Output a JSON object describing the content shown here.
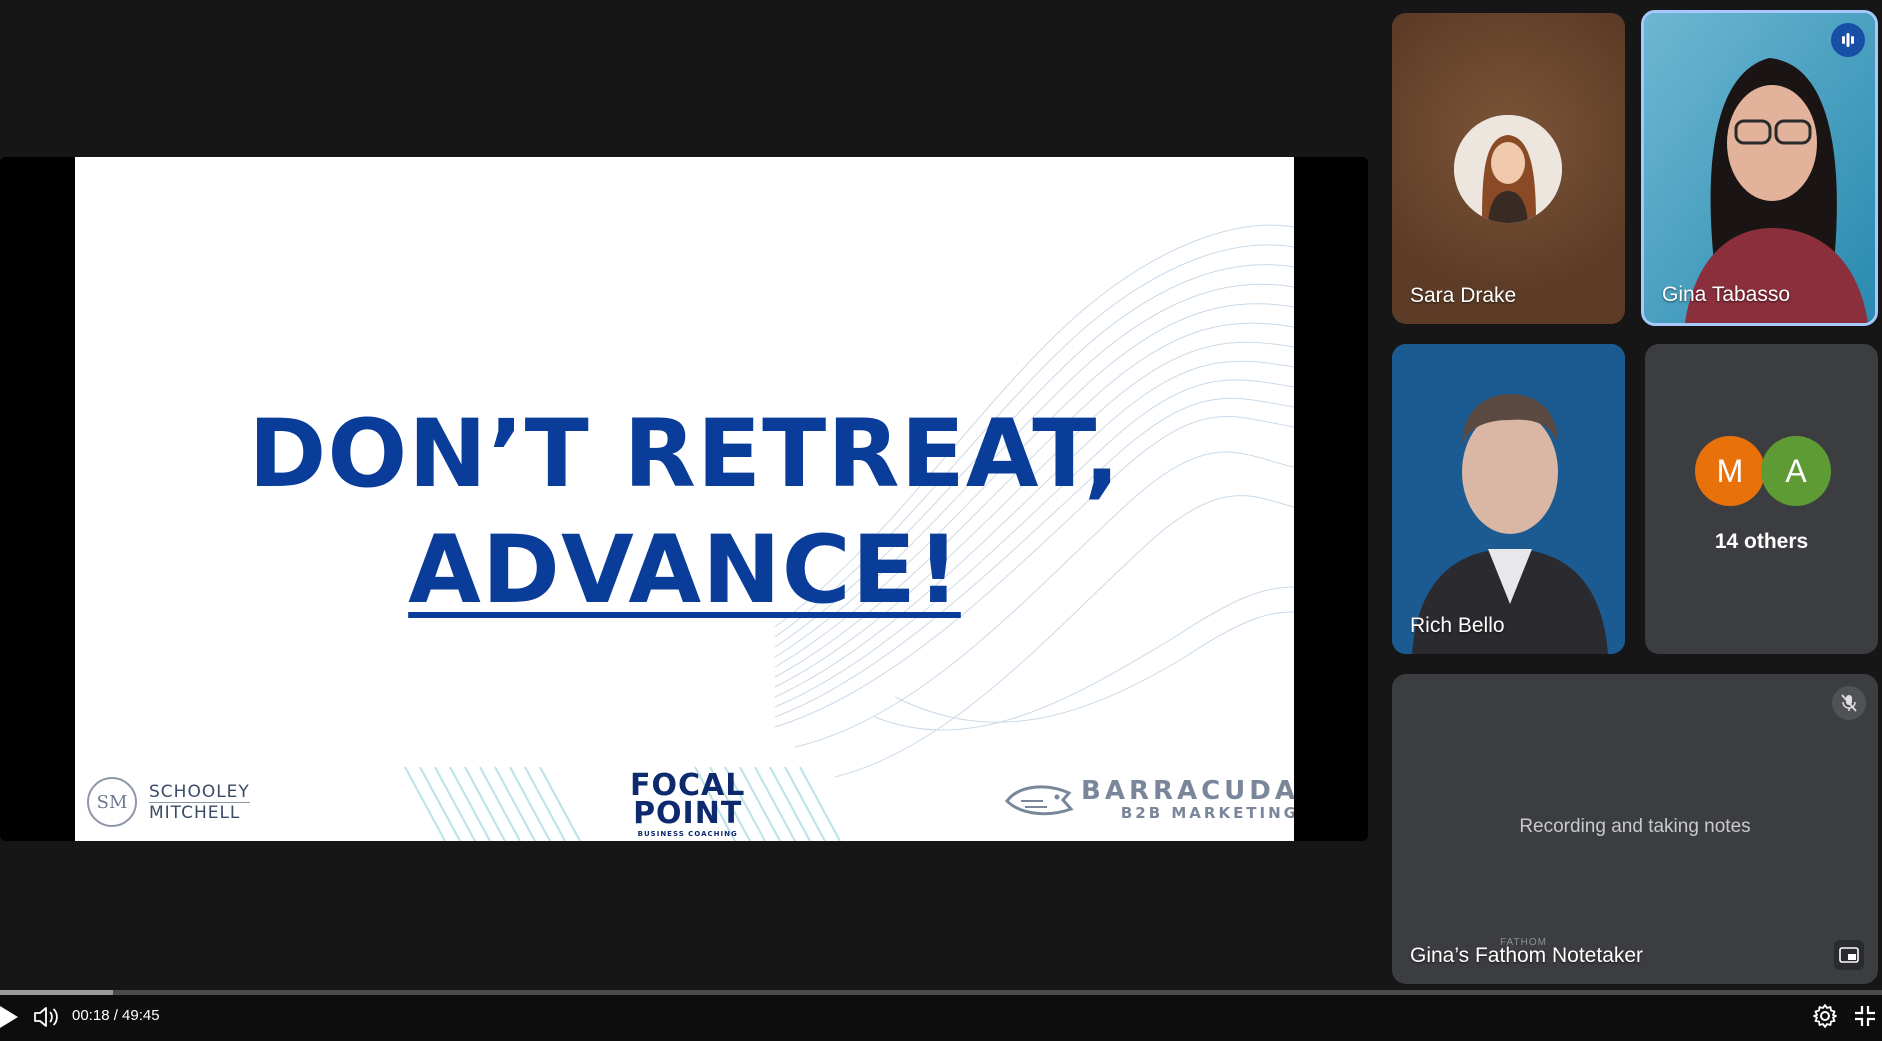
{
  "slide": {
    "title_line1": "DON’T RETREAT,",
    "title_line2": "ADVANCE!",
    "logo_schooley_line1": "SCHOOLEY",
    "logo_schooley_line2": "MITCHELL",
    "logo_focal_line1": "FOCAL",
    "logo_focal_line2": "POINT",
    "logo_focal_sub": "BUSINESS COACHING",
    "logo_barracuda_name": "BARRACUDA",
    "logo_barracuda_sub": "B2B MARKETING",
    "title_color": "#0a3d9a"
  },
  "participants": {
    "sara": {
      "name": "Sara Drake"
    },
    "gina": {
      "name": "Gina Tabasso"
    },
    "rich": {
      "name": "Rich Bello"
    },
    "others": {
      "initials": [
        "M",
        "A"
      ],
      "label": "14 others"
    },
    "notetaker": {
      "name": "Gina’s Fathom Notetaker",
      "status": "Recording and taking notes",
      "banner": "FATHOM"
    }
  },
  "controls": {
    "time": "00:18 / 49:45",
    "progress_fraction": 0.006,
    "icons": [
      "play-icon",
      "volume-icon",
      "settings-icon",
      "exit-fullscreen-icon"
    ]
  },
  "colors": {
    "speaking_border": "#a8c7fa",
    "avatar_m": "#e8710a",
    "avatar_a": "#5e9b35"
  }
}
